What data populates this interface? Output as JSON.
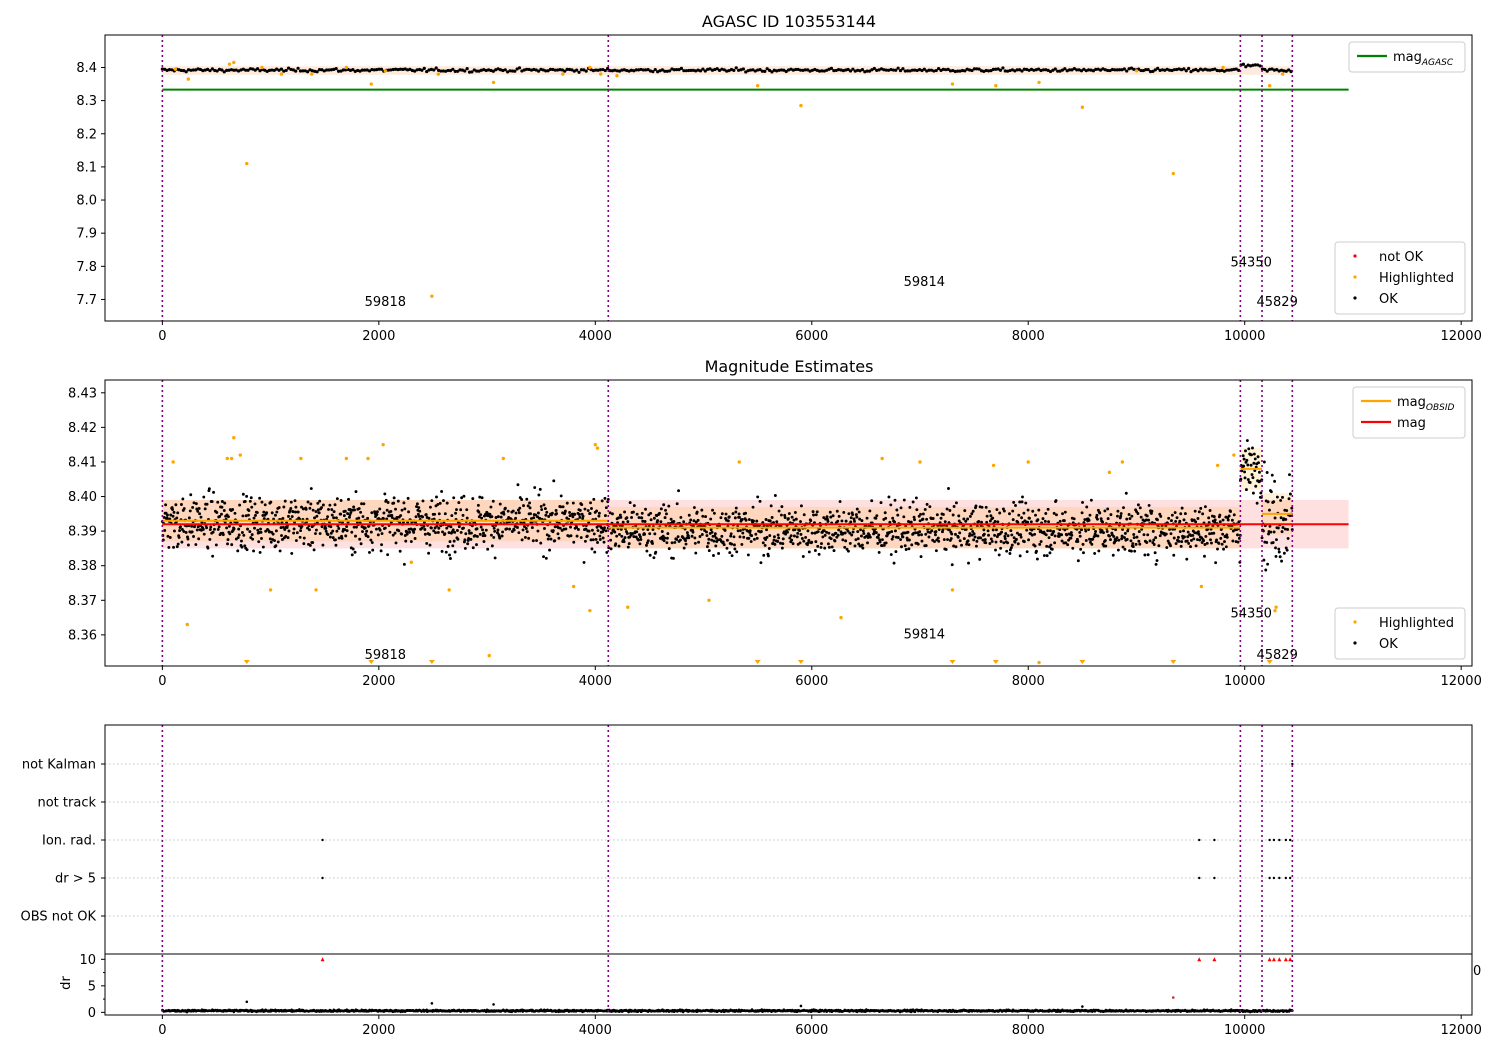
{
  "chart_data": [
    {
      "id": "p1",
      "type": "scatter",
      "title": "AGASC ID 103553144",
      "xlim": [
        -530,
        12100
      ],
      "ylim": [
        7.635,
        8.498
      ],
      "xticks": [
        0,
        2000,
        4000,
        6000,
        8000,
        10000,
        12000
      ],
      "xtick_labels": [
        "0",
        "2000",
        "4000",
        "6000",
        "8000",
        "10000",
        "12000"
      ],
      "yticks": [
        7.7,
        7.8,
        7.9,
        8.0,
        8.1,
        8.2,
        8.3,
        8.4
      ],
      "ytick_labels": [
        "7.7",
        "7.8",
        "7.9",
        "8.0",
        "8.1",
        "8.2",
        "8.3",
        "8.4"
      ],
      "vlines": [
        0,
        4120,
        9960,
        10160,
        10440
      ],
      "hlines": [
        {
          "y": 8.333,
          "x0": 0,
          "x1": 10960,
          "color": "#008000",
          "name": "mag_AGASC"
        }
      ],
      "annotations": [
        {
          "text": "59818",
          "x": 2060,
          "y": 7.68
        },
        {
          "text": "59814",
          "x": 7040,
          "y": 7.74
        },
        {
          "text": "54350",
          "x": 10060,
          "y": 7.8
        },
        {
          "text": "45829",
          "x": 10300,
          "y": 7.68
        }
      ],
      "band": {
        "y0": 8.378,
        "y1": 8.404,
        "segments": [
          [
            0,
            4120
          ],
          [
            4120,
            9960
          ],
          [
            9960,
            10160
          ],
          [
            10160,
            10440
          ]
        ]
      },
      "ok_points": {
        "x_step": 22,
        "y_center": 8.392,
        "y_spread": 0.006,
        "bump": {
          "x0": 9960,
          "x1": 10160,
          "y": 8.405
        }
      },
      "highlighted_points": [
        [
          120,
          8.395
        ],
        [
          240,
          8.365
        ],
        [
          620,
          8.41
        ],
        [
          660,
          8.415
        ],
        [
          780,
          8.11
        ],
        [
          920,
          8.4
        ],
        [
          1100,
          8.38
        ],
        [
          1380,
          8.38
        ],
        [
          1700,
          8.4
        ],
        [
          1930,
          8.35
        ],
        [
          2060,
          8.39
        ],
        [
          2490,
          7.71
        ],
        [
          2550,
          8.38
        ],
        [
          3060,
          8.355
        ],
        [
          3700,
          8.38
        ],
        [
          3950,
          8.4
        ],
        [
          4050,
          8.38
        ],
        [
          4200,
          8.375
        ],
        [
          5500,
          8.345
        ],
        [
          5900,
          8.285
        ],
        [
          7300,
          8.35
        ],
        [
          7700,
          8.345
        ],
        [
          8100,
          8.355
        ],
        [
          8500,
          8.28
        ],
        [
          9000,
          8.39
        ],
        [
          9340,
          8.08
        ],
        [
          9800,
          8.4
        ],
        [
          10230,
          8.345
        ],
        [
          10350,
          8.38
        ]
      ],
      "legends": [
        {
          "position": "top-right",
          "items": [
            {
              "label": "mag",
              "sub": "AGASC",
              "kind": "line",
              "color": "#008000"
            }
          ]
        },
        {
          "position": "bottom-right",
          "items": [
            {
              "label": "not OK",
              "kind": "dot",
              "color": "#ff0000"
            },
            {
              "label": "Highlighted",
              "kind": "dot",
              "color": "#ffa500"
            },
            {
              "label": "OK",
              "kind": "dot",
              "color": "#000000"
            }
          ]
        }
      ]
    },
    {
      "id": "p2",
      "type": "scatter",
      "title": "Magnitude Estimates",
      "xlim": [
        -530,
        12100
      ],
      "ylim": [
        8.351,
        8.4337
      ],
      "xticks": [
        0,
        2000,
        4000,
        6000,
        8000,
        10000,
        12000
      ],
      "xtick_labels": [
        "0",
        "2000",
        "4000",
        "6000",
        "8000",
        "10000",
        "12000"
      ],
      "yticks": [
        8.36,
        8.37,
        8.38,
        8.39,
        8.4,
        8.41,
        8.42,
        8.43
      ],
      "ytick_labels": [
        "8.36",
        "8.37",
        "8.38",
        "8.39",
        "8.40",
        "8.41",
        "8.42",
        "8.43"
      ],
      "vlines": [
        0,
        4120,
        9960,
        10160,
        10440
      ],
      "mag": {
        "value": 8.392,
        "band": [
          8.385,
          8.399
        ],
        "x0": 0,
        "x1": 10960,
        "color": "#ff0000"
      },
      "mag_obsid": [
        {
          "x0": 0,
          "x1": 4120,
          "y": 8.393
        },
        {
          "x0": 4120,
          "x1": 9960,
          "y": 8.391
        },
        {
          "x0": 9960,
          "x1": 10160,
          "y": 8.408
        },
        {
          "x0": 10160,
          "x1": 10440,
          "y": 8.395
        }
      ],
      "annotations": [
        {
          "text": "59818",
          "x": 2060,
          "y": 8.353
        },
        {
          "text": "59814",
          "x": 7040,
          "y": 8.359
        },
        {
          "text": "54350",
          "x": 10060,
          "y": 8.365
        },
        {
          "text": "45829",
          "x": 10300,
          "y": 8.353
        }
      ],
      "ok_points": {
        "x_step": 4.3,
        "segments": [
          {
            "x0": 0,
            "x1": 4120,
            "y": 8.3925,
            "spread": 0.0054
          },
          {
            "x0": 4120,
            "x1": 9960,
            "y": 8.3905,
            "spread": 0.0052
          },
          {
            "x0": 9960,
            "x1": 10160,
            "y": 8.408,
            "spread": 0.0055
          },
          {
            "x0": 10160,
            "x1": 10440,
            "y": 8.394,
            "spread": 0.009
          }
        ]
      },
      "highlighted_points": [
        [
          100,
          8.41
        ],
        [
          230,
          8.363
        ],
        [
          600,
          8.411
        ],
        [
          640,
          8.411
        ],
        [
          660,
          8.417
        ],
        [
          720,
          8.412
        ],
        [
          1000,
          8.373
        ],
        [
          1280,
          8.411
        ],
        [
          1420,
          8.373
        ],
        [
          1700,
          8.411
        ],
        [
          1900,
          8.411
        ],
        [
          2040,
          8.415
        ],
        [
          2300,
          8.381
        ],
        [
          2650,
          8.373
        ],
        [
          3020,
          8.354
        ],
        [
          3150,
          8.411
        ],
        [
          3800,
          8.374
        ],
        [
          3950,
          8.367
        ],
        [
          4000,
          8.415
        ],
        [
          4020,
          8.414
        ],
        [
          4300,
          8.368
        ],
        [
          5050,
          8.37
        ],
        [
          5330,
          8.41
        ],
        [
          6270,
          8.365
        ],
        [
          6650,
          8.411
        ],
        [
          7000,
          8.41
        ],
        [
          7300,
          8.373
        ],
        [
          7680,
          8.409
        ],
        [
          8000,
          8.41
        ],
        [
          8100,
          8.352
        ],
        [
          8750,
          8.407
        ],
        [
          8870,
          8.41
        ],
        [
          9600,
          8.374
        ],
        [
          9750,
          8.409
        ],
        [
          9900,
          8.412
        ],
        [
          10280,
          8.367
        ],
        [
          10290,
          8.368
        ]
      ],
      "offscale_markers_x": [
        780,
        1930,
        2490,
        5500,
        5900,
        7300,
        7700,
        8500,
        9340,
        10230
      ],
      "legends": [
        {
          "position": "top-right",
          "items": [
            {
              "label": "mag",
              "sub": "OBSID",
              "kind": "line",
              "color": "#ffa500"
            },
            {
              "label": "mag",
              "sub": "",
              "kind": "line",
              "color": "#ff0000"
            }
          ]
        },
        {
          "position": "bottom-right",
          "items": [
            {
              "label": "Highlighted",
              "kind": "dot",
              "color": "#ffa500"
            },
            {
              "label": "OK",
              "kind": "dot",
              "color": "#000000"
            }
          ]
        }
      ]
    },
    {
      "id": "p3",
      "type": "scatter",
      "xlim": [
        -530,
        12100
      ],
      "vlines": [
        0,
        4120,
        9960,
        10160,
        10440
      ],
      "flag_rows": [
        "not Kalman",
        "not track",
        "Ion. rad.",
        "dr > 5",
        "OBS not OK"
      ],
      "flag_points": [
        {
          "row": "Ion. rad.",
          "x": [
            1480,
            9580,
            9720,
            10230,
            10270,
            10320,
            10380,
            10420
          ]
        },
        {
          "row": "dr > 5",
          "x": [
            1480,
            9580,
            9720,
            10230,
            10270,
            10320,
            10380,
            10420
          ]
        },
        {
          "row": "not Kalman",
          "x": [
            10440
          ]
        }
      ],
      "dr_panel": {
        "ylabel": "dr",
        "ylim": [
          -0.5,
          11
        ],
        "yticks": [
          0,
          5,
          10
        ],
        "ytick_labels": [
          "0",
          "5",
          "10"
        ],
        "clip_y": 10,
        "clipped_x": [
          1480,
          9580,
          9720,
          10230,
          10270,
          10320,
          10380,
          10420
        ],
        "ok_points": {
          "x_step": 6,
          "y_center": 0.3,
          "y_spread": 0.25
        },
        "extra_points": [
          [
            780,
            2
          ],
          [
            2490,
            1.7
          ],
          [
            3060,
            1.5
          ],
          [
            5900,
            1.2
          ],
          [
            8500,
            1.1
          ],
          [
            9340,
            2.8
          ]
        ],
        "edge_tick_label": "0"
      },
      "xticks": [
        0,
        2000,
        4000,
        6000,
        8000,
        10000,
        12000
      ],
      "xtick_labels": [
        "0",
        "2000",
        "4000",
        "6000",
        "8000",
        "10000",
        "12000"
      ]
    }
  ]
}
